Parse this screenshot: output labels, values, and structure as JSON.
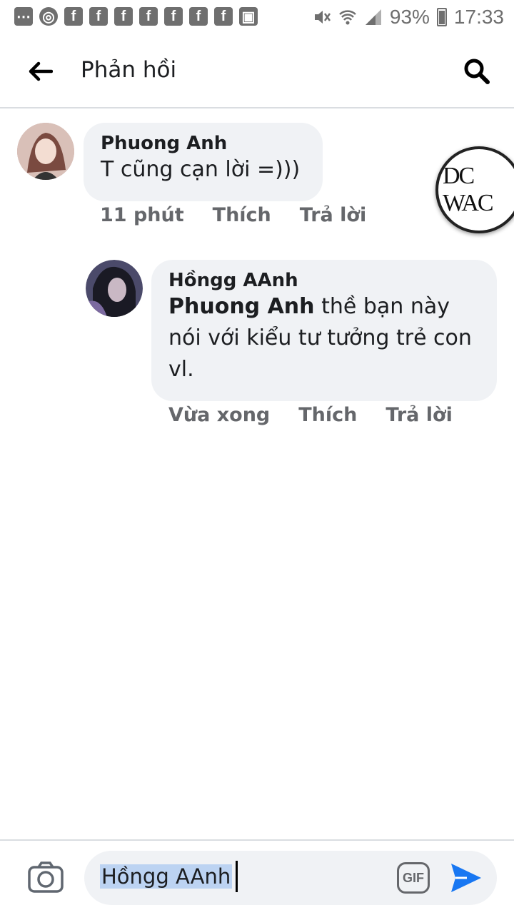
{
  "status_bar": {
    "battery": "93%",
    "time": "17:33",
    "icons": [
      "messages-icon",
      "chrome-icon",
      "facebook-icon",
      "facebook-icon",
      "facebook-icon",
      "facebook-icon",
      "facebook-icon",
      "facebook-icon",
      "facebook-icon",
      "image-icon",
      "mute-icon",
      "wifi-icon",
      "signal-icon",
      "battery-icon"
    ]
  },
  "header": {
    "title": "Phản hồi",
    "back_icon": "arrow-left-icon",
    "search_icon": "search-icon"
  },
  "comments": [
    {
      "author": "Phuong Anh",
      "text": "T cũng cạn lời =)))",
      "time": "11 phút",
      "like": "Thích",
      "reply": "Trả lời"
    },
    {
      "author": "Hồngg AAnh",
      "mention": "Phuong Anh",
      "text": "thề bạn này nói với kiểu tư tưởng trẻ con vl.",
      "time": "Vừa xong",
      "like": "Thích",
      "reply": "Trả lời"
    }
  ],
  "watermark": "DC WAC",
  "composer": {
    "value": "Hồngg AAnh",
    "camera_icon": "camera-icon",
    "gif_label": "GIF",
    "send_icon": "send-icon"
  },
  "colors": {
    "bubble": "#f0f2f5",
    "meta_text": "#65676b",
    "send": "#1877f2",
    "selection": "#bcd3f2"
  }
}
